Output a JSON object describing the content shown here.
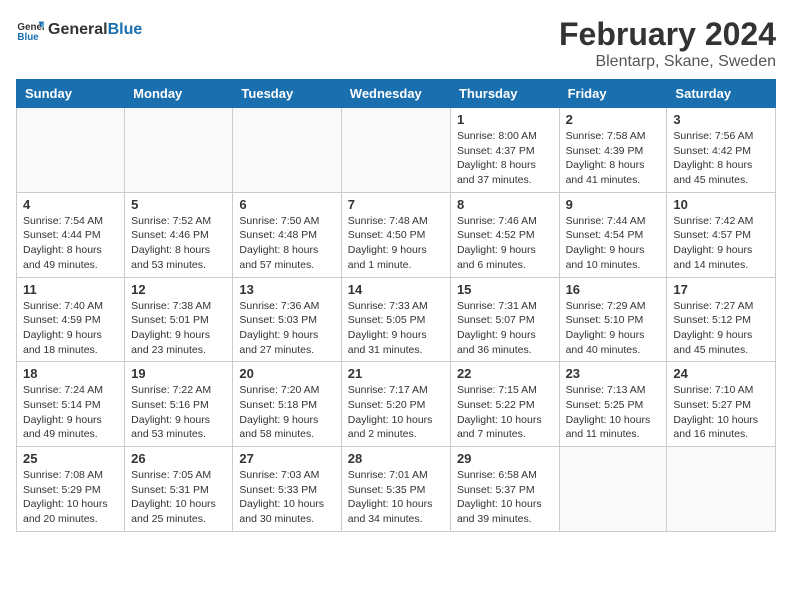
{
  "header": {
    "logo_general": "General",
    "logo_blue": "Blue",
    "title": "February 2024",
    "subtitle": "Blentarp, Skane, Sweden"
  },
  "weekdays": [
    "Sunday",
    "Monday",
    "Tuesday",
    "Wednesday",
    "Thursday",
    "Friday",
    "Saturday"
  ],
  "weeks": [
    [
      {
        "day": "",
        "info": ""
      },
      {
        "day": "",
        "info": ""
      },
      {
        "day": "",
        "info": ""
      },
      {
        "day": "",
        "info": ""
      },
      {
        "day": "1",
        "info": "Sunrise: 8:00 AM\nSunset: 4:37 PM\nDaylight: 8 hours\nand 37 minutes."
      },
      {
        "day": "2",
        "info": "Sunrise: 7:58 AM\nSunset: 4:39 PM\nDaylight: 8 hours\nand 41 minutes."
      },
      {
        "day": "3",
        "info": "Sunrise: 7:56 AM\nSunset: 4:42 PM\nDaylight: 8 hours\nand 45 minutes."
      }
    ],
    [
      {
        "day": "4",
        "info": "Sunrise: 7:54 AM\nSunset: 4:44 PM\nDaylight: 8 hours\nand 49 minutes."
      },
      {
        "day": "5",
        "info": "Sunrise: 7:52 AM\nSunset: 4:46 PM\nDaylight: 8 hours\nand 53 minutes."
      },
      {
        "day": "6",
        "info": "Sunrise: 7:50 AM\nSunset: 4:48 PM\nDaylight: 8 hours\nand 57 minutes."
      },
      {
        "day": "7",
        "info": "Sunrise: 7:48 AM\nSunset: 4:50 PM\nDaylight: 9 hours\nand 1 minute."
      },
      {
        "day": "8",
        "info": "Sunrise: 7:46 AM\nSunset: 4:52 PM\nDaylight: 9 hours\nand 6 minutes."
      },
      {
        "day": "9",
        "info": "Sunrise: 7:44 AM\nSunset: 4:54 PM\nDaylight: 9 hours\nand 10 minutes."
      },
      {
        "day": "10",
        "info": "Sunrise: 7:42 AM\nSunset: 4:57 PM\nDaylight: 9 hours\nand 14 minutes."
      }
    ],
    [
      {
        "day": "11",
        "info": "Sunrise: 7:40 AM\nSunset: 4:59 PM\nDaylight: 9 hours\nand 18 minutes."
      },
      {
        "day": "12",
        "info": "Sunrise: 7:38 AM\nSunset: 5:01 PM\nDaylight: 9 hours\nand 23 minutes."
      },
      {
        "day": "13",
        "info": "Sunrise: 7:36 AM\nSunset: 5:03 PM\nDaylight: 9 hours\nand 27 minutes."
      },
      {
        "day": "14",
        "info": "Sunrise: 7:33 AM\nSunset: 5:05 PM\nDaylight: 9 hours\nand 31 minutes."
      },
      {
        "day": "15",
        "info": "Sunrise: 7:31 AM\nSunset: 5:07 PM\nDaylight: 9 hours\nand 36 minutes."
      },
      {
        "day": "16",
        "info": "Sunrise: 7:29 AM\nSunset: 5:10 PM\nDaylight: 9 hours\nand 40 minutes."
      },
      {
        "day": "17",
        "info": "Sunrise: 7:27 AM\nSunset: 5:12 PM\nDaylight: 9 hours\nand 45 minutes."
      }
    ],
    [
      {
        "day": "18",
        "info": "Sunrise: 7:24 AM\nSunset: 5:14 PM\nDaylight: 9 hours\nand 49 minutes."
      },
      {
        "day": "19",
        "info": "Sunrise: 7:22 AM\nSunset: 5:16 PM\nDaylight: 9 hours\nand 53 minutes."
      },
      {
        "day": "20",
        "info": "Sunrise: 7:20 AM\nSunset: 5:18 PM\nDaylight: 9 hours\nand 58 minutes."
      },
      {
        "day": "21",
        "info": "Sunrise: 7:17 AM\nSunset: 5:20 PM\nDaylight: 10 hours\nand 2 minutes."
      },
      {
        "day": "22",
        "info": "Sunrise: 7:15 AM\nSunset: 5:22 PM\nDaylight: 10 hours\nand 7 minutes."
      },
      {
        "day": "23",
        "info": "Sunrise: 7:13 AM\nSunset: 5:25 PM\nDaylight: 10 hours\nand 11 minutes."
      },
      {
        "day": "24",
        "info": "Sunrise: 7:10 AM\nSunset: 5:27 PM\nDaylight: 10 hours\nand 16 minutes."
      }
    ],
    [
      {
        "day": "25",
        "info": "Sunrise: 7:08 AM\nSunset: 5:29 PM\nDaylight: 10 hours\nand 20 minutes."
      },
      {
        "day": "26",
        "info": "Sunrise: 7:05 AM\nSunset: 5:31 PM\nDaylight: 10 hours\nand 25 minutes."
      },
      {
        "day": "27",
        "info": "Sunrise: 7:03 AM\nSunset: 5:33 PM\nDaylight: 10 hours\nand 30 minutes."
      },
      {
        "day": "28",
        "info": "Sunrise: 7:01 AM\nSunset: 5:35 PM\nDaylight: 10 hours\nand 34 minutes."
      },
      {
        "day": "29",
        "info": "Sunrise: 6:58 AM\nSunset: 5:37 PM\nDaylight: 10 hours\nand 39 minutes."
      },
      {
        "day": "",
        "info": ""
      },
      {
        "day": "",
        "info": ""
      }
    ]
  ]
}
